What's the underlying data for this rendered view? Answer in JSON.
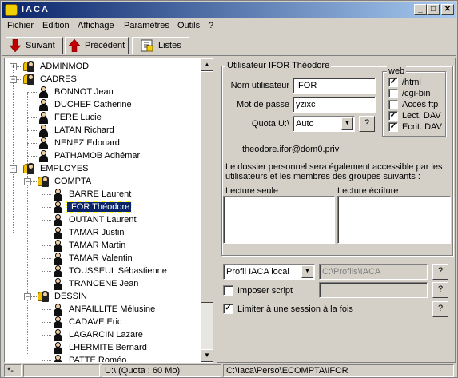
{
  "window": {
    "title": "IACA",
    "controls": {
      "minimize": "_",
      "maximize": "□",
      "close": "✕"
    }
  },
  "menu": [
    "Fichier",
    "Edition",
    "Affichage",
    "Paramètres",
    "Outils",
    "?"
  ],
  "toolbar": {
    "next_label": "Suivant",
    "prev_label": "Précédent",
    "lists_label": "Listes"
  },
  "tree": {
    "nodes": [
      {
        "label": "ADMINMOD",
        "type": "group",
        "level": 0,
        "expander": "+"
      },
      {
        "label": "CADRES",
        "type": "group",
        "level": 0,
        "expander": "−"
      },
      {
        "label": "BONNOT Jean",
        "type": "user",
        "level": 1
      },
      {
        "label": "DUCHEF Catherine",
        "type": "user",
        "level": 1
      },
      {
        "label": "FERE Lucie",
        "type": "user",
        "level": 1
      },
      {
        "label": "LATAN Richard",
        "type": "user",
        "level": 1
      },
      {
        "label": "NENEZ Edouard",
        "type": "user",
        "level": 1
      },
      {
        "label": "PATHAMOB Adhémar",
        "type": "user",
        "level": 1
      },
      {
        "label": "EMPLOYES",
        "type": "group",
        "level": 0,
        "expander": "−"
      },
      {
        "label": "COMPTA",
        "type": "group",
        "level": 1,
        "expander": "−"
      },
      {
        "label": "BARRE Laurent",
        "type": "user",
        "level": 2
      },
      {
        "label": "IFOR Théodore",
        "type": "user",
        "level": 2,
        "selected": true
      },
      {
        "label": "OUTANT Laurent",
        "type": "user",
        "level": 2
      },
      {
        "label": "TAMAR Justin",
        "type": "user",
        "level": 2
      },
      {
        "label": "TAMAR Martin",
        "type": "user",
        "level": 2
      },
      {
        "label": "TAMAR Valentin",
        "type": "user",
        "level": 2
      },
      {
        "label": "TOUSSEUL Sébastienne",
        "type": "user",
        "level": 2
      },
      {
        "label": "TRANCENE Jean",
        "type": "user",
        "level": 2
      },
      {
        "label": "DESSIN",
        "type": "group",
        "level": 1,
        "expander": "−"
      },
      {
        "label": "ANFAILLITE Mélusine",
        "type": "user",
        "level": 2
      },
      {
        "label": "CADAVE Eric",
        "type": "user",
        "level": 2
      },
      {
        "label": "LAGARCIN Lazare",
        "type": "user",
        "level": 2
      },
      {
        "label": "LHERMITE Bernard",
        "type": "user",
        "level": 2
      },
      {
        "label": "PATTE Roméo",
        "type": "user",
        "level": 2
      }
    ]
  },
  "user_panel": {
    "group_title": "Utilisateur IFOR Théodore",
    "username_label": "Nom utilisateur",
    "username_value": "IFOR",
    "password_label": "Mot de passe",
    "password_value": "yzixc",
    "quota_label": "Quota U:\\",
    "quota_value": "Auto",
    "help": "?",
    "email": "theodore.ifor@dom0.priv",
    "shared_text_1": "Le dossier personnel sera également accessible par les",
    "shared_text_2": "utilisateurs et les membres des groupes suivants :",
    "read_only_label": "Lecture seule",
    "read_write_label": "Lecture écriture",
    "web": {
      "title": "web",
      "options": [
        {
          "label": "/html",
          "checked": true
        },
        {
          "label": "/cgi-bin",
          "checked": false
        },
        {
          "label": "Accès ftp",
          "checked": false
        },
        {
          "label": "Lect. DAV",
          "checked": true
        },
        {
          "label": "Ecrit. DAV",
          "checked": true
        }
      ]
    },
    "profile_select": "Profil IACA local",
    "profile_path": "C:\\Profils\\IACA",
    "impose_script_label": "Imposer script",
    "impose_script_checked": false,
    "limit_session_label": "Limiter à une session à la fois",
    "limit_session_checked": true
  },
  "status": {
    "pane1": "*-",
    "pane2": "",
    "pane3": "U:\\  (Quota : 60 Mo)",
    "pane4": "C:\\Iaca\\Perso\\ECOMPTA\\IFOR"
  }
}
